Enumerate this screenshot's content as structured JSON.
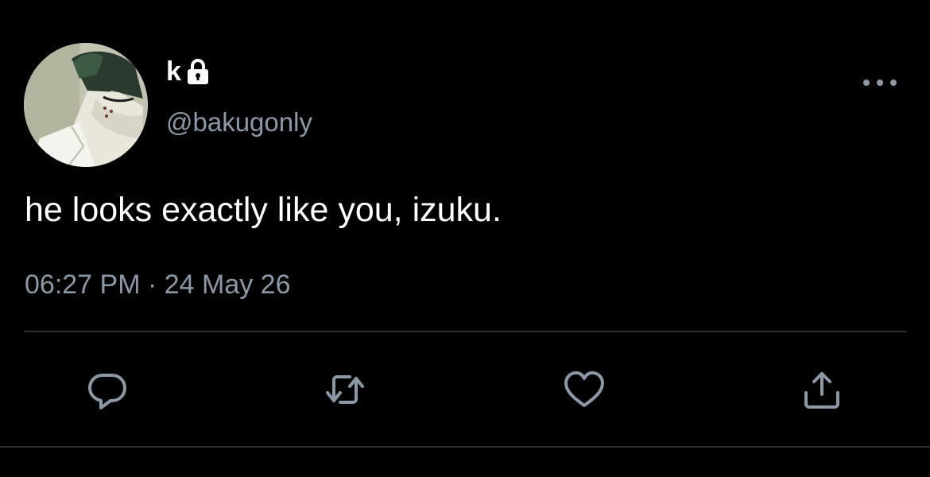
{
  "user": {
    "display_name": "k",
    "handle": "@bakugonly",
    "avatar_icon": "anime-avatar",
    "protected_icon": "lock-icon"
  },
  "tweet": {
    "text": "he looks exactly like you, izuku.",
    "timestamp": "06:27 PM · 24 May 26"
  },
  "actions": {
    "more_icon": "more-icon",
    "reply_icon": "reply-icon",
    "retweet_icon": "retweet-icon",
    "like_icon": "heart-icon",
    "share_icon": "share-icon"
  },
  "colors": {
    "background": "#000000",
    "primary_text": "#ffffff",
    "secondary_text": "#8b98a5",
    "divider": "#2f3336"
  }
}
